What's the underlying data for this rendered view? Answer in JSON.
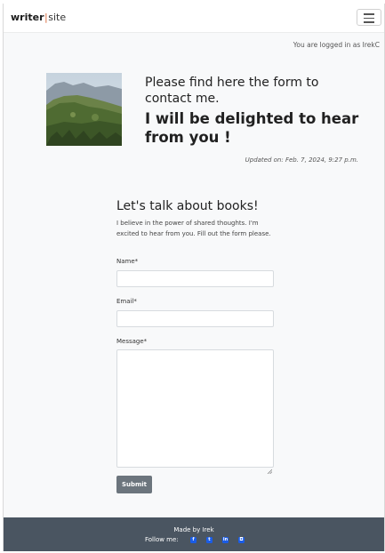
{
  "navbar": {
    "brand_part1": "writer",
    "brand_separator": "|",
    "brand_part2": "site",
    "menu_icon": "hamburger-icon"
  },
  "session": {
    "logged_in_text": "You are logged in as IrekC"
  },
  "hero": {
    "image_icon": "landscape-photo",
    "subtitle": "Please find here the form to contact me.",
    "title": "I will be delighted to hear from you !",
    "updated": "Updated on: Feb. 7, 2024, 9:27 p.m."
  },
  "contact": {
    "heading": "Let's talk about books!",
    "intro": "I believe in the power of shared thoughts. I'm excited to hear from you. Fill out the form please.",
    "name_label": "Name*",
    "name_value": "",
    "email_label": "Email*",
    "email_value": "",
    "message_label": "Message*",
    "message_value": "",
    "submit_label": "Submit"
  },
  "footer": {
    "made_by": "Made by Irek",
    "follow_label": "Follow me:",
    "social": [
      {
        "icon": "facebook-icon",
        "glyph": "f"
      },
      {
        "icon": "twitter-icon",
        "glyph": "t"
      },
      {
        "icon": "linkedin-icon",
        "glyph": "in"
      },
      {
        "icon": "instagram-icon",
        "glyph": "◘"
      }
    ]
  },
  "colors": {
    "page_bg": "#f8f9fa",
    "footer_bg": "#4a5561",
    "button_bg": "#6c757d",
    "social_blue": "#1a5ce6",
    "brand_accent": "#d96a3c"
  }
}
